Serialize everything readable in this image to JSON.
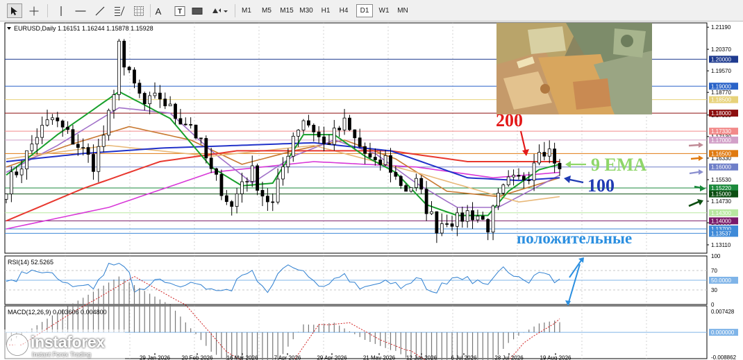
{
  "toolbar": {
    "tools": [
      {
        "name": "cursor-tool",
        "icon": "arrow-cursor-icon"
      },
      {
        "name": "crosshair-tool",
        "icon": "crosshair-icon"
      },
      {
        "name": "vertical-line-tool",
        "icon": "vertical-line-icon"
      },
      {
        "name": "horizontal-line-tool",
        "icon": "horizontal-line-icon"
      },
      {
        "name": "trendline-tool",
        "icon": "trendline-icon"
      },
      {
        "name": "fibonacci-tool",
        "icon": "fibonacci-icon"
      },
      {
        "name": "grid-tool",
        "icon": "grid-icon"
      },
      {
        "name": "text-tool",
        "icon": "text-icon",
        "label": "A"
      },
      {
        "name": "text-label-tool",
        "icon": "text-label-icon",
        "label": "T"
      },
      {
        "name": "rectangle-tool",
        "icon": "rectangle-icon"
      },
      {
        "name": "shapes-tool",
        "icon": "shapes-icon"
      }
    ],
    "timeframes": [
      "M1",
      "M5",
      "M15",
      "M30",
      "H1",
      "H4",
      "D1",
      "W1",
      "MN"
    ],
    "active_timeframe": "D1"
  },
  "chart": {
    "title": "EURUSD,Daily  1.16151 1.16244 1.15878 1.15928",
    "rsi_label": "RSI(14) 52.5265",
    "macd_label": "MACD(12,26,9) 0.003606 0.004800"
  },
  "annotations": {
    "ma200_label": "200",
    "ema9_label": "9 EMA",
    "ma100_label": "100",
    "positive_label": "положительные"
  },
  "logo": {
    "name": "instaforex",
    "subtitle": "Instant Forex Trading"
  },
  "colors": {
    "ma200": "#e8382f",
    "ema9": "#18a02c",
    "ma100": "#2132c9",
    "magenta_ma": "#d838d8",
    "brown_ma": "#c87830",
    "purple_ma": "#a070c8",
    "annotation_red": "#e31a1a",
    "annotation_green": "#8fd66a",
    "annotation_blue": "#1f3bb3",
    "annotation_lightblue": "#2b8fe0"
  },
  "chart_data": [
    {
      "type": "candlestick",
      "symbol": "EURUSD",
      "timeframe": "Daily",
      "ohlc_last": {
        "open": 1.16151,
        "high": 1.16244,
        "low": 1.15878,
        "close": 1.15928
      },
      "x_tick_labels": [
        "29 Jan 2026",
        "20 Feb 2026",
        "16 Mar 2026",
        "7 Apr 2026",
        "29 Apr 2026",
        "21 May 2026",
        "12 Jun 2026",
        "6 Jul 2026",
        "28 Jul 2026",
        "19 Aug 2026"
      ],
      "y_tick_labels": [
        "1.21190",
        "1.20370",
        "1.19570",
        "1.18770",
        "1.17930",
        "1.17130",
        "1.16330",
        "1.15530",
        "1.14730",
        "1.13930",
        "1.13110"
      ],
      "ylim": [
        1.128,
        1.2135
      ],
      "level_labels": [
        {
          "value": 1.2,
          "label": "1.20000",
          "color": "#1f3b8f"
        },
        {
          "value": 1.19,
          "label": "1.19000",
          "color": "#2a63c8"
        },
        {
          "value": 1.185,
          "label": "1.18500",
          "color": "#e7d27a"
        },
        {
          "value": 1.18,
          "label": "1.18000",
          "color": "#8c0f0f"
        },
        {
          "value": 1.1733,
          "label": "1.17330",
          "color": "#f28a8a"
        },
        {
          "value": 1.17,
          "label": "1.17000",
          "color": "#d2a0c8"
        },
        {
          "value": 1.165,
          "label": "1.16500",
          "color": "#e07a10"
        },
        {
          "value": 1.16,
          "label": "1.16000",
          "color": "#6f7fc8"
        },
        {
          "value": 1.1522,
          "label": "1.15220",
          "color": "#1b8a3c"
        },
        {
          "value": 1.15,
          "label": "1.15000",
          "color": "#0d4f12"
        },
        {
          "value": 1.143,
          "label": "1.14300",
          "color": "#b8e8a0"
        },
        {
          "value": 1.14,
          "label": "1.14000",
          "color": "#7a1a6a"
        },
        {
          "value": 1.137,
          "label": "1.13700",
          "color": "#3f8ad8"
        },
        {
          "value": 1.13537,
          "label": "1.13537",
          "color": "#3f8ad8"
        }
      ],
      "price_path": [
        [
          0,
          1.153
        ],
        [
          3,
          1.161
        ],
        [
          6,
          1.172
        ],
        [
          9,
          1.178
        ],
        [
          12,
          1.172
        ],
        [
          15,
          1.166
        ],
        [
          17,
          1.161
        ],
        [
          19,
          1.172
        ],
        [
          21,
          1.185
        ],
        [
          22,
          1.209
        ],
        [
          23,
          1.197
        ],
        [
          25,
          1.19
        ],
        [
          27,
          1.183
        ],
        [
          30,
          1.186
        ],
        [
          33,
          1.179
        ],
        [
          36,
          1.176
        ],
        [
          38,
          1.168
        ],
        [
          40,
          1.158
        ],
        [
          42,
          1.152
        ],
        [
          44,
          1.145
        ],
        [
          46,
          1.155
        ],
        [
          48,
          1.158
        ],
        [
          50,
          1.15
        ],
        [
          52,
          1.146
        ],
        [
          54,
          1.16
        ],
        [
          56,
          1.172
        ],
        [
          58,
          1.178
        ],
        [
          60,
          1.174
        ],
        [
          62,
          1.168
        ],
        [
          64,
          1.172
        ],
        [
          66,
          1.176
        ],
        [
          68,
          1.17
        ],
        [
          70,
          1.165
        ],
        [
          72,
          1.16
        ],
        [
          74,
          1.163
        ],
        [
          76,
          1.156
        ],
        [
          78,
          1.152
        ],
        [
          80,
          1.154
        ],
        [
          82,
          1.145
        ],
        [
          84,
          1.138
        ],
        [
          86,
          1.141
        ],
        [
          88,
          1.14
        ],
        [
          90,
          1.143
        ],
        [
          92,
          1.142
        ],
        [
          94,
          1.138
        ],
        [
          96,
          1.148
        ],
        [
          98,
          1.154
        ],
        [
          100,
          1.155
        ],
        [
          102,
          1.158
        ],
        [
          104,
          1.168
        ],
        [
          106,
          1.166
        ],
        [
          108,
          1.16
        ]
      ],
      "moving_averages": [
        {
          "name": "200",
          "color": "#e8382f",
          "values": [
            [
              0,
              1.14
            ],
            [
              15,
              1.152
            ],
            [
              30,
              1.162
            ],
            [
              45,
              1.166
            ],
            [
              60,
              1.166
            ],
            [
              75,
              1.166
            ],
            [
              90,
              1.162
            ],
            [
              108,
              1.162
            ]
          ]
        },
        {
          "name": "100",
          "color": "#2132c9",
          "values": [
            [
              0,
              1.162
            ],
            [
              15,
              1.165
            ],
            [
              30,
              1.167
            ],
            [
              45,
              1.168
            ],
            [
              60,
              1.169
            ],
            [
              75,
              1.166
            ],
            [
              90,
              1.156
            ],
            [
              100,
              1.155
            ],
            [
              108,
              1.156
            ]
          ]
        },
        {
          "name": "9 EMA",
          "color": "#18a02c",
          "values": [
            [
              0,
              1.157
            ],
            [
              10,
              1.172
            ],
            [
              22,
              1.188
            ],
            [
              32,
              1.178
            ],
            [
              40,
              1.16
            ],
            [
              46,
              1.153
            ],
            [
              52,
              1.154
            ],
            [
              58,
              1.172
            ],
            [
              64,
              1.172
            ],
            [
              70,
              1.164
            ],
            [
              76,
              1.158
            ],
            [
              82,
              1.146
            ],
            [
              88,
              1.142
            ],
            [
              94,
              1.142
            ],
            [
              98,
              1.151
            ],
            [
              104,
              1.159
            ],
            [
              108,
              1.161
            ]
          ]
        }
      ]
    },
    {
      "type": "line",
      "title": "RSI(14) 52.5265",
      "y_tick_labels": [
        "100",
        "70",
        "30",
        "0"
      ],
      "level_labels": [
        {
          "value": 50,
          "label": "50.0000"
        }
      ],
      "ylim": [
        0,
        100
      ],
      "last_value": 52.5265
    },
    {
      "type": "bar",
      "title": "MACD(12,26,9) 0.003606 0.004800",
      "y_tick_labels": [
        "0.007428",
        "0.000000",
        "-0.008862"
      ],
      "level_labels": [
        {
          "value": 0,
          "label": "0.000000"
        }
      ],
      "ylim": [
        -0.008862,
        0.007428
      ],
      "last_values": {
        "main": 0.003606,
        "signal": 0.0048
      }
    }
  ]
}
